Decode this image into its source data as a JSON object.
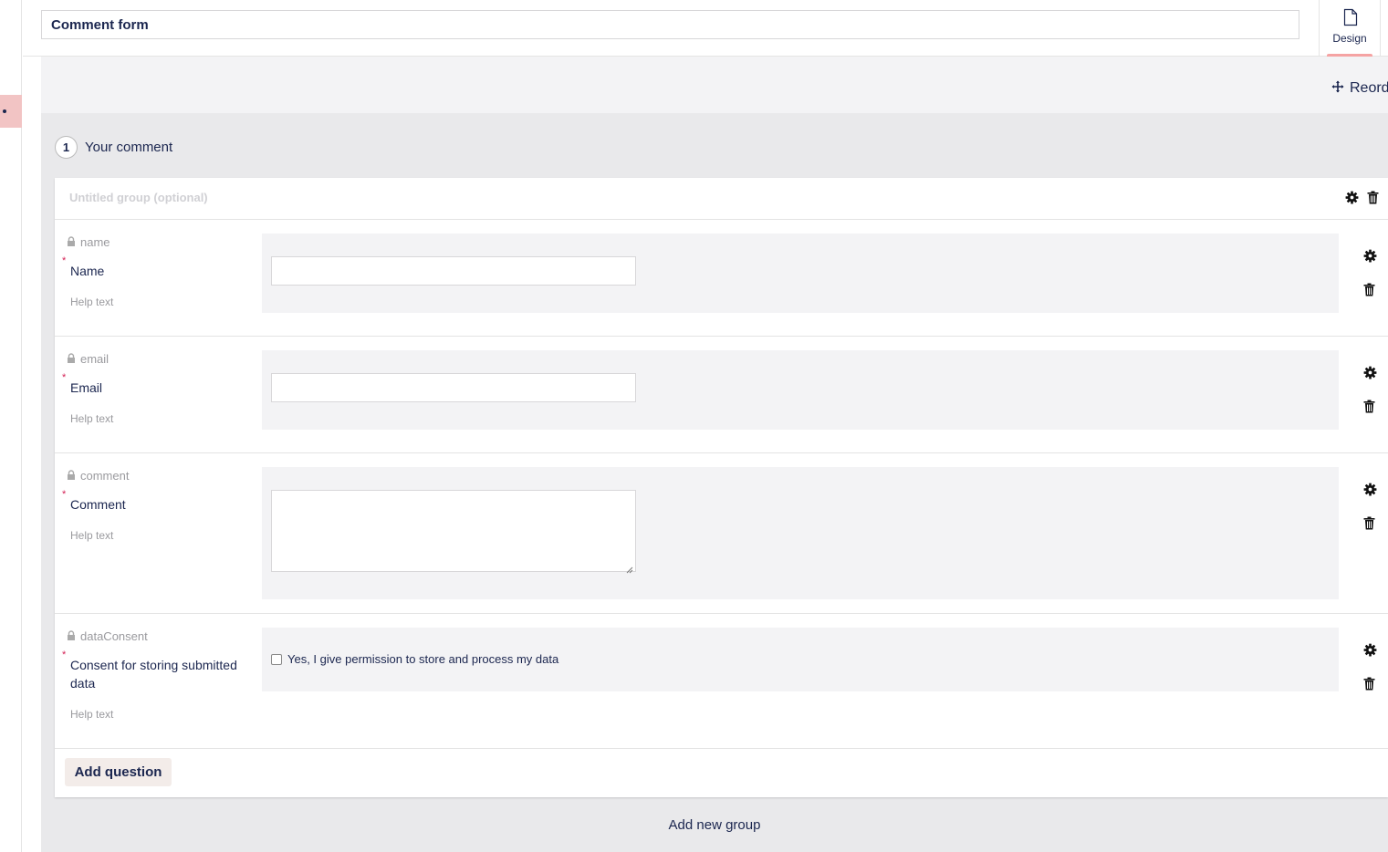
{
  "header": {
    "form_title": "Comment form",
    "apps": [
      {
        "label": "Design",
        "icon": "document-icon",
        "active": true
      }
    ]
  },
  "toolbar": {
    "reorder_label": "Reord"
  },
  "tab": {
    "number": "1",
    "name": "Your comment"
  },
  "group": {
    "title_placeholder": "Untitled group (optional)"
  },
  "questions": [
    {
      "alias": "name",
      "label": "Name",
      "required": true,
      "help": "Help text",
      "type": "textbox"
    },
    {
      "alias": "email",
      "label": "Email",
      "required": true,
      "help": "Help text",
      "type": "textbox"
    },
    {
      "alias": "comment",
      "label": "Comment",
      "required": true,
      "help": "Help text",
      "type": "textarea"
    },
    {
      "alias": "dataConsent",
      "label": "Consent for storing submitted data",
      "required": true,
      "help": "Help text",
      "type": "checkbox",
      "option_text": "Yes, I give permission to store and process my data"
    }
  ],
  "actions": {
    "add_question": "Add question",
    "add_group": "Add new group"
  },
  "colors": {
    "text_primary": "#1b264f",
    "required": "#d42054",
    "active_tab_highlight": "#f5a3a3",
    "panel_bg": "#e9e9eb",
    "preview_bg": "#f3f3f5",
    "button_bg": "#f3ece9"
  }
}
